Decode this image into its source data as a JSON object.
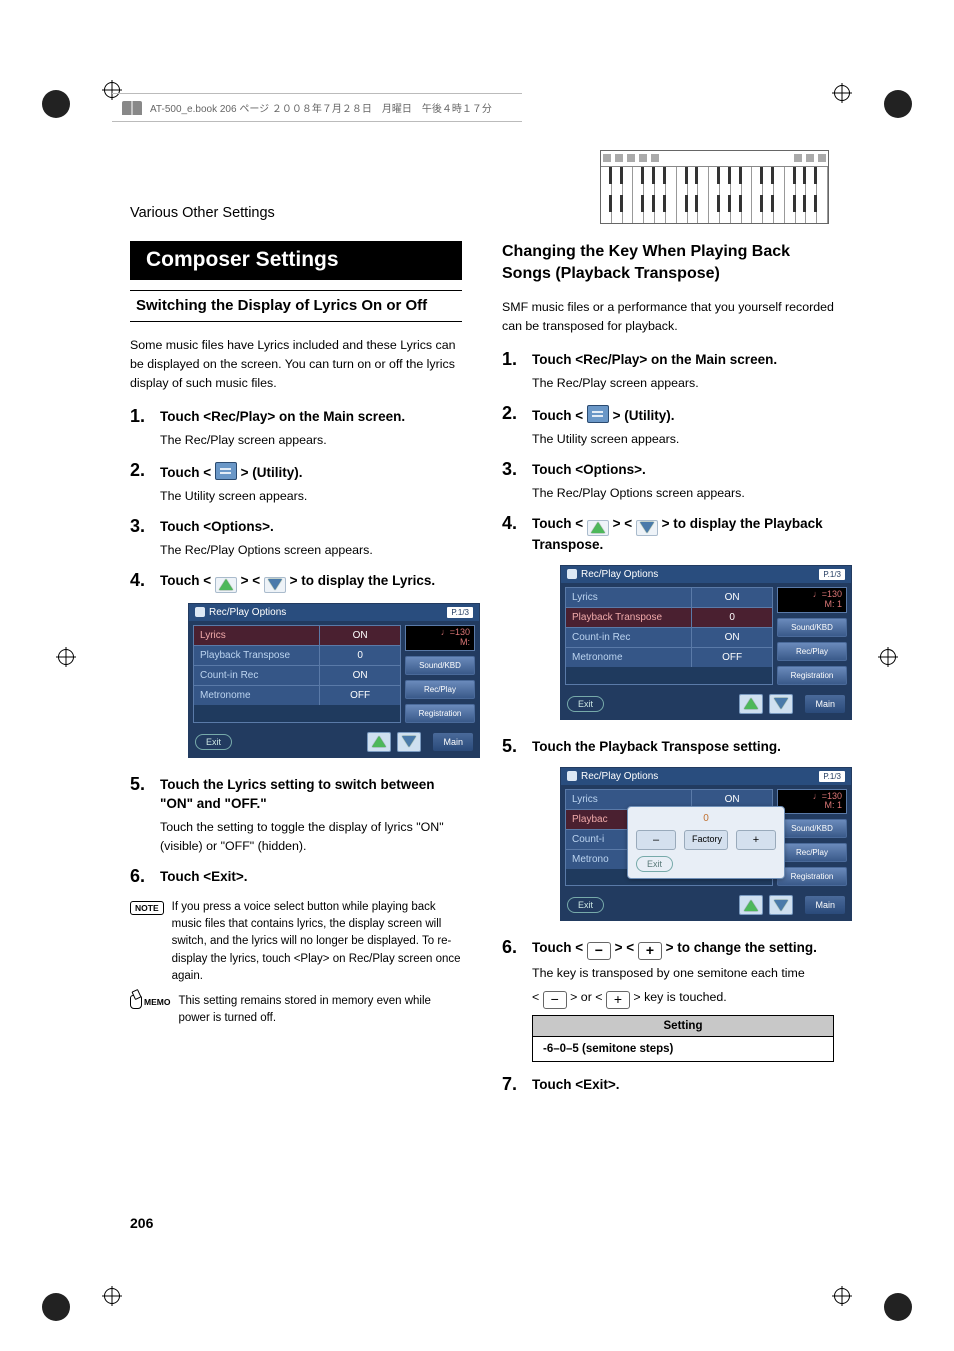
{
  "book_header": "AT-500_e.book  206 ページ  ２００８年７月２８日　月曜日　午後４時１７分",
  "section_name": "Various Other Settings",
  "page_number": "206",
  "left": {
    "h1": "Composer Settings",
    "h2": "Switching the Display of Lyrics On or Off",
    "intro": "Some music files have Lyrics included and these Lyrics can be displayed on the screen. You can turn on or off the lyrics display of such music files.",
    "steps": [
      {
        "title": "Touch <Rec/Play> on the Main screen.",
        "sub": "The Rec/Play screen appears."
      },
      {
        "title_a": "Touch < ",
        "title_b": " > (Utility).",
        "sub": "The Utility screen appears."
      },
      {
        "title": "Touch <Options>.",
        "sub": "The Rec/Play Options screen appears."
      },
      {
        "title_a": "Touch < ",
        "title_mid": " > < ",
        "title_b": " > to display the Lyrics."
      },
      {
        "title": "Touch the Lyrics setting to switch between \"ON\" and \"OFF.\"",
        "sub": "Touch the setting to toggle the display of lyrics \"ON\" (visible) or \"OFF\" (hidden)."
      },
      {
        "title": "Touch <Exit>."
      }
    ],
    "note": "If you press a voice select button while playing back music files that contains lyrics, the display screen will switch, and the lyrics will no longer be displayed. To re-display the lyrics, touch <Play> on Rec/Play screen once again.",
    "memo": "This setting remains stored in memory even while power is turned off.",
    "screenshot": {
      "title": "Rec/Play Options",
      "page_badge": "P.1/3",
      "tempo_top": "♩=130",
      "tempo_bottom": "M:",
      "rows": [
        {
          "label": "Lyrics",
          "value": "ON",
          "sel": true
        },
        {
          "label": "Playback Transpose",
          "value": "0"
        },
        {
          "label": "Count-in Rec",
          "value": "ON"
        },
        {
          "label": "Metronome",
          "value": "OFF"
        }
      ],
      "side": [
        "Sound/KBD",
        "Rec/Play",
        "Registration"
      ],
      "exit": "Exit",
      "main": "Main"
    }
  },
  "right": {
    "h2": "Changing the Key When Playing Back Songs (Playback Transpose)",
    "intro": "SMF music files or a performance that you yourself recorded can be transposed for playback.",
    "steps": [
      {
        "title": "Touch <Rec/Play> on the Main screen.",
        "sub": "The Rec/Play screen appears."
      },
      {
        "title_a": "Touch < ",
        "title_b": " > (Utility).",
        "sub": "The Utility screen appears."
      },
      {
        "title": "Touch <Options>.",
        "sub": "The Rec/Play Options screen appears."
      },
      {
        "title_a": "Touch < ",
        "title_mid": " > < ",
        "title_b": " > to display the Playback Transpose."
      },
      {
        "title": "Touch the Playback Transpose setting."
      },
      {
        "title_a": "Touch < ",
        "title_mid": " > < ",
        "title_b": " > to change the setting.",
        "sub_a": "The key is transposed by one semitone each time",
        "sub_b_pre": "< ",
        "sub_b_mid": " > or < ",
        "sub_b_post": " > key is touched."
      },
      {
        "title": "Touch <Exit>."
      }
    ],
    "table": {
      "header": "Setting",
      "value": "-6–0–5 (semitone steps)"
    },
    "screenshot1": {
      "title": "Rec/Play Options",
      "page_badge": "P.1/3",
      "tempo_top": "♩=130",
      "tempo_bottom": "M:       1",
      "rows": [
        {
          "label": "Lyrics",
          "value": "ON"
        },
        {
          "label": "Playback Transpose",
          "value": "0",
          "sel": true
        },
        {
          "label": "Count-in Rec",
          "value": "ON"
        },
        {
          "label": "Metronome",
          "value": "OFF"
        }
      ],
      "side": [
        "Sound/KBD",
        "Rec/Play",
        "Registration"
      ],
      "exit": "Exit",
      "main": "Main"
    },
    "screenshot2": {
      "title": "Rec/Play Options",
      "page_badge": "P.1/3",
      "tempo_top": "♩=130",
      "tempo_bottom": "M:       1",
      "rows": [
        {
          "label": "Lyrics",
          "value": "ON"
        },
        {
          "label": "Playbac",
          "value": ""
        },
        {
          "label": "Count-i",
          "value": ""
        },
        {
          "label": "Metrono",
          "value": ""
        }
      ],
      "side": [
        "Sound/KBD",
        "Rec/Play",
        "Registration"
      ],
      "exit": "Exit",
      "main": "Main",
      "popup": {
        "value": "0",
        "minus": "–",
        "factory": "Factory",
        "plus": "+",
        "exit": "Exit"
      }
    }
  },
  "labels": {
    "note": "NOTE",
    "memo": "MEMO"
  }
}
